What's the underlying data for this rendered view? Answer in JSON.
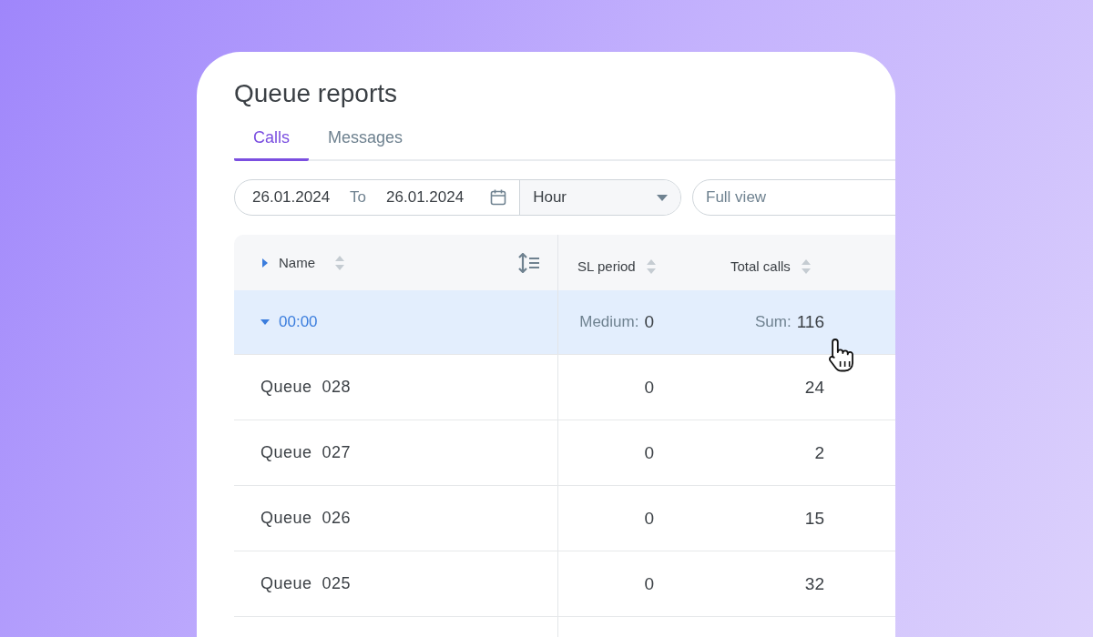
{
  "title": "Queue reports",
  "tabs": [
    {
      "label": "Calls",
      "selected": true
    },
    {
      "label": "Messages",
      "selected": false
    }
  ],
  "filters": {
    "date_from": "26.01.2024",
    "to_label": "To",
    "date_to": "26.01.2024",
    "interval": "Hour",
    "view": {
      "placeholder": "Full view"
    }
  },
  "table": {
    "expand_all": {
      "expanded": false
    },
    "columns": [
      "Name",
      "SL period",
      "Total calls"
    ],
    "groups": [
      {
        "label": "00:00",
        "expanded": true,
        "selected": true,
        "summary": [
          {
            "label": "Medium:",
            "value": "0"
          },
          {
            "label": "Sum:",
            "value": "116"
          }
        ],
        "rows": [
          {
            "name": "Queue  028",
            "cells": [
              "0",
              "24"
            ]
          },
          {
            "name": "Queue  027",
            "cells": [
              "0",
              "2"
            ]
          },
          {
            "name": "Queue  026",
            "cells": [
              "0",
              "15"
            ]
          },
          {
            "name": "Queue  025",
            "cells": [
              "0",
              "32"
            ]
          }
        ]
      }
    ]
  }
}
